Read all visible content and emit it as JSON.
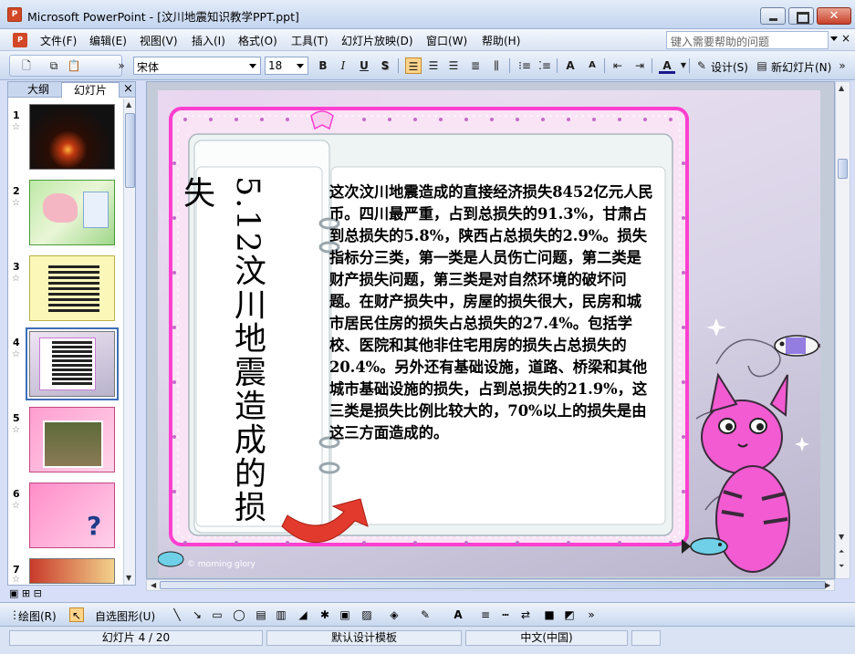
{
  "window": {
    "title": "Microsoft PowerPoint - [汶川地震知识教学PPT.ppt]",
    "app_icon": "P",
    "close_glyph": "✕"
  },
  "menu": {
    "doc_icon": "P",
    "items": [
      "文件(F)",
      "编辑(E)",
      "视图(V)",
      "插入(I)",
      "格式(O)",
      "工具(T)",
      "幻灯片放映(D)",
      "窗口(W)",
      "帮助(H)"
    ],
    "help_placeholder": "键入需要帮助的问题",
    "help_close": "×"
  },
  "toolbar": {
    "font_name": "宋体",
    "font_size": "18",
    "bold": "B",
    "italic": "I",
    "underline": "U",
    "shadow": "S",
    "grow_font": "A",
    "shrink_font": "A",
    "font_color": "A",
    "design_label": "设计(S)",
    "new_slide_label": "新幻灯片(N)"
  },
  "pane": {
    "tab_outline": "大纲",
    "tab_slides": "幻灯片",
    "close": "×",
    "slides": [
      {
        "num": "1"
      },
      {
        "num": "2"
      },
      {
        "num": "3"
      },
      {
        "num": "4",
        "selected": true
      },
      {
        "num": "5"
      },
      {
        "num": "6"
      },
      {
        "num": "7"
      }
    ]
  },
  "slide": {
    "title": "5.12汶川地震造成的损失",
    "body": "这次汶川地震造成的直接经济损失8452亿元人民币。四川最严重，占到总损失的91.3%，甘肃占到总损失的5.8%，陕西占总损失的2.9%。损失指标分三类，第一类是人员伤亡问题，第二类是财产损失问题，第三类是对自然环境的破坏问题。在财产损失中，房屋的损失很大，民房和城市居民住房的损失占总损失的27.4%。包括学校、医院和其他非住宅用房的损失占总损失的20.4%。另外还有基础设施，道路、桥梁和其他城市基础设施的损失，占到总损失的21.9%，这三类是损失比例比较大的，70%以上的损失是由这三方面造成的。",
    "watermark": "© morning glory"
  },
  "drawbar": {
    "draw_label": "绘图(R)",
    "autoshape_label": "自选图形(U)"
  },
  "status": {
    "slide_info": "幻灯片 4 / 20",
    "template": "默认设计模板",
    "language": "中文(中国)"
  }
}
